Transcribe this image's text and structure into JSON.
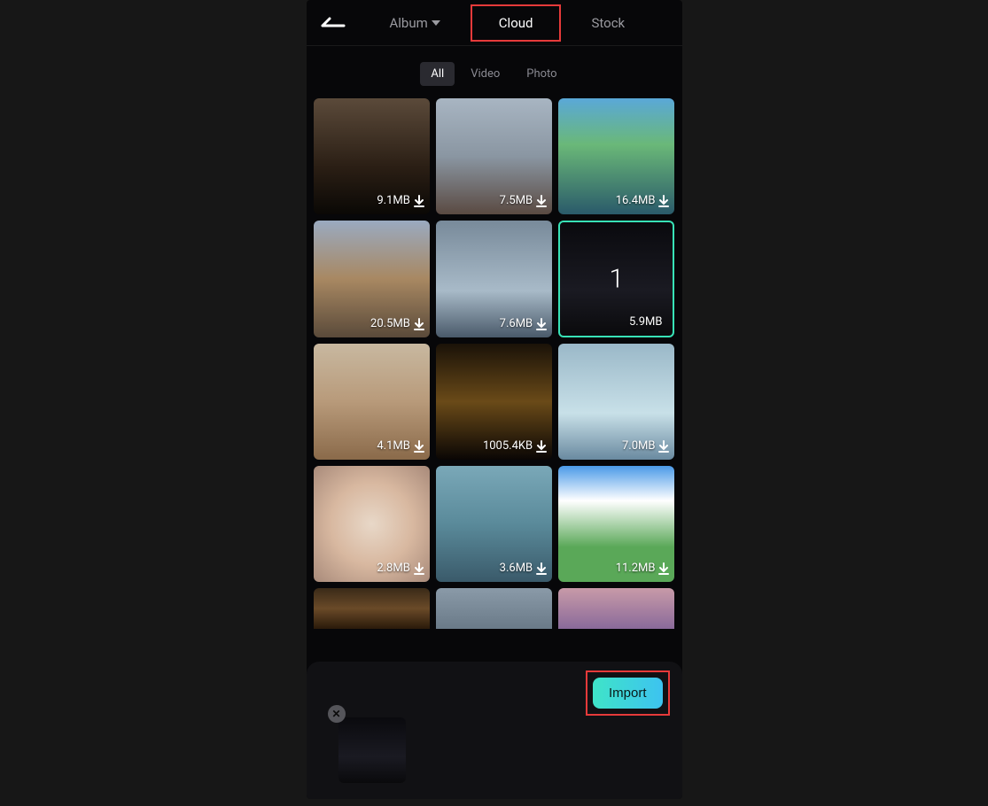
{
  "header": {
    "album_label": "Album",
    "cloud_label": "Cloud",
    "stock_label": "Stock"
  },
  "filters": {
    "all": "All",
    "video": "Video",
    "photo": "Photo"
  },
  "tiles": [
    {
      "size": "9.1MB",
      "bg": "bg1",
      "dl": true,
      "selected": false
    },
    {
      "size": "7.5MB",
      "bg": "bg2",
      "dl": true,
      "selected": false
    },
    {
      "size": "16.4MB",
      "bg": "bg3",
      "dl": true,
      "selected": false
    },
    {
      "size": "20.5MB",
      "bg": "bg4",
      "dl": true,
      "selected": false
    },
    {
      "size": "7.6MB",
      "bg": "bg5",
      "dl": true,
      "selected": false
    },
    {
      "size": "5.9MB",
      "bg": "bg6",
      "dl": false,
      "selected": true,
      "num": "1"
    },
    {
      "size": "4.1MB",
      "bg": "bg7",
      "dl": true,
      "selected": false
    },
    {
      "size": "1005.4KB",
      "bg": "bg8",
      "dl": true,
      "selected": false
    },
    {
      "size": "7.0MB",
      "bg": "bg9",
      "dl": true,
      "selected": false
    },
    {
      "size": "2.8MB",
      "bg": "bg10",
      "dl": true,
      "selected": false
    },
    {
      "size": "3.6MB",
      "bg": "bg11",
      "dl": true,
      "selected": false
    },
    {
      "size": "11.2MB",
      "bg": "bg12",
      "dl": true,
      "selected": false
    }
  ],
  "partial_tiles": [
    {
      "bg": "bg13"
    },
    {
      "bg": "bg14"
    },
    {
      "bg": "bg15"
    }
  ],
  "tray": {
    "import_label": "Import",
    "thumb_bg": "bg6"
  }
}
